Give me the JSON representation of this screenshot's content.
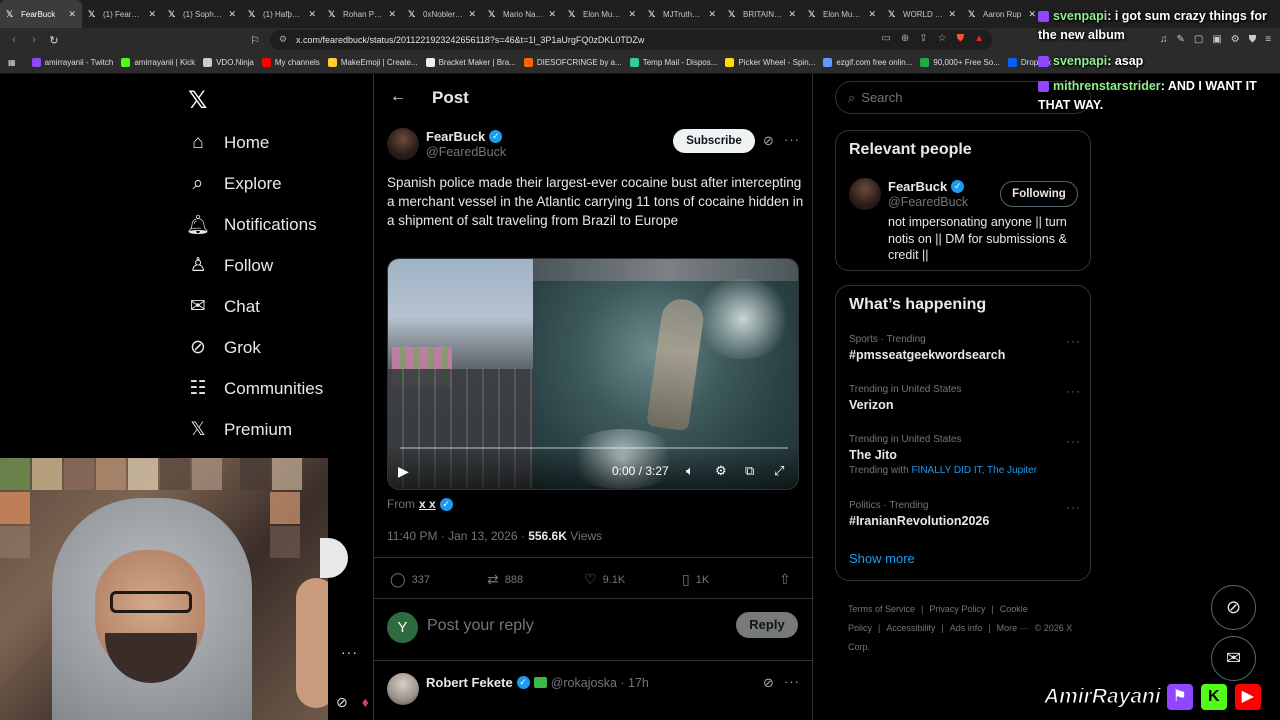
{
  "browser": {
    "tabs": [
      {
        "label": "FearBuck",
        "active": true
      },
      {
        "label": "(1) FearBuck"
      },
      {
        "label": "(1) Sophie Ra"
      },
      {
        "label": "(1) Hafþór J B"
      },
      {
        "label": "Rohan Paul on"
      },
      {
        "label": "0xNobler on"
      },
      {
        "label": "Mario Nawfal"
      },
      {
        "label": "Elon Musk on"
      },
      {
        "label": "MJTruthUltra"
      },
      {
        "label": "BRITAIN IS BR"
      },
      {
        "label": "Elon Musk on"
      },
      {
        "label": "WORLD NEW"
      },
      {
        "label": "Aaron Rup"
      }
    ],
    "url": "x.com/fearedbuck/status/2011221923242656118?s=46&t=1l_3P1aUrgFQ0zDKL0TDZw",
    "bookmarks": [
      {
        "label": "amirrayanii - Twitch",
        "color": "#9147ff"
      },
      {
        "label": "amirrayanii | Kick",
        "color": "#53fc18"
      },
      {
        "label": "VDO.Ninja",
        "color": "#cccccc"
      },
      {
        "label": "My channels",
        "color": "#ff0000"
      },
      {
        "label": "MakeEmoji | Create...",
        "color": "#ffcc33"
      },
      {
        "label": "Bracket Maker | Bra...",
        "color": "#eeeeee"
      },
      {
        "label": "DIESOFCRINGE by a...",
        "color": "#ff6600"
      },
      {
        "label": "Temp Mail - Dispos...",
        "color": "#33cc99"
      },
      {
        "label": "Picker Wheel - Spin...",
        "color": "#ffdd00"
      },
      {
        "label": "ezgif.com free onlin...",
        "color": "#6699ff"
      },
      {
        "label": "90,000+ Free So...",
        "color": "#22aa44"
      },
      {
        "label": "Dropbox",
        "color": "#0061ff"
      }
    ]
  },
  "nav": {
    "items": [
      {
        "label": "Home",
        "icon": "home-icon",
        "glyph": "⌂"
      },
      {
        "label": "Explore",
        "icon": "search-icon",
        "glyph": "⌕"
      },
      {
        "label": "Notifications",
        "icon": "bell-icon",
        "glyph": "🔔︎"
      },
      {
        "label": "Follow",
        "icon": "person-add-icon",
        "glyph": "♙"
      },
      {
        "label": "Chat",
        "icon": "mail-icon",
        "glyph": "✉"
      },
      {
        "label": "Grok",
        "icon": "grok-icon",
        "glyph": "⊘"
      },
      {
        "label": "Communities",
        "icon": "communities-icon",
        "glyph": "☷"
      },
      {
        "label": "Premium",
        "icon": "x-premium-icon",
        "glyph": "𝕏"
      }
    ]
  },
  "post": {
    "header_title": "Post",
    "author_name": "FearBuck",
    "author_handle": "@FearedBuck",
    "subscribe_label": "Subscribe",
    "text": "Spanish police made their largest-ever cocaine bust after intercepting a merchant vessel in the Atlantic carrying 11 tons of cocaine hidden in a shipment of salt traveling from Brazil to Europe",
    "video": {
      "time": "0:00 / 3:27"
    },
    "from_label": "From",
    "from_user": "x x",
    "time": "11:40 PM · Jan 13, 2026 · ",
    "views": "556.6K",
    "views_label": " Views",
    "stats": {
      "replies": "337",
      "reposts": "888",
      "likes": "9.1K",
      "bookmarks": "1K"
    },
    "reply_placeholder": "Post your reply",
    "reply_avatar_letter": "Y",
    "reply_button": "Reply"
  },
  "next_reply": {
    "name": "Robert Fekete",
    "handle": "@rokajoska · 17h"
  },
  "sidebar": {
    "search_placeholder": "Search",
    "relevant_title": "Relevant people",
    "relevant": {
      "name": "FearBuck",
      "handle": "@FearedBuck",
      "follow_label": "Following",
      "bio": "not impersonating anyone || turn notis on || DM for submissions & credit ||"
    },
    "happening_title": "What’s happening",
    "trends": [
      {
        "meta": "Sports · Trending",
        "name": "#pmsseatgeekwordsearch"
      },
      {
        "meta": "Trending in United States",
        "name": "Verizon"
      },
      {
        "meta": "Trending in United States",
        "name": "The Jito",
        "with_label": "Trending with ",
        "with_links": "FINALLY DID IT, The Jupiter"
      },
      {
        "meta": "Politics · Trending",
        "name": "#IranianRevolution2026"
      }
    ],
    "show_more": "Show more",
    "footer": [
      "Terms of Service",
      "|",
      "Privacy Policy",
      "|",
      "Cookie Policy",
      "|",
      "Accessibility",
      "|",
      "Ads info",
      "|",
      "More ···",
      "© 2026 X Corp."
    ]
  },
  "chat": [
    {
      "user": "svenpapi",
      "message": ": i got sum crazy things for the new album"
    },
    {
      "user": "svenpapi",
      "message": ": asap"
    },
    {
      "user": "mithrenstarstrider",
      "message": ": AND I WANT IT THAT WAY."
    }
  ],
  "brand": {
    "name": "AmirRayani"
  },
  "colors": {
    "accent": "#1d9bf0",
    "background": "#000000",
    "muted": "#71767b",
    "twitch": "#9147ff",
    "kick": "#53fc18",
    "youtube": "#ff0000"
  }
}
